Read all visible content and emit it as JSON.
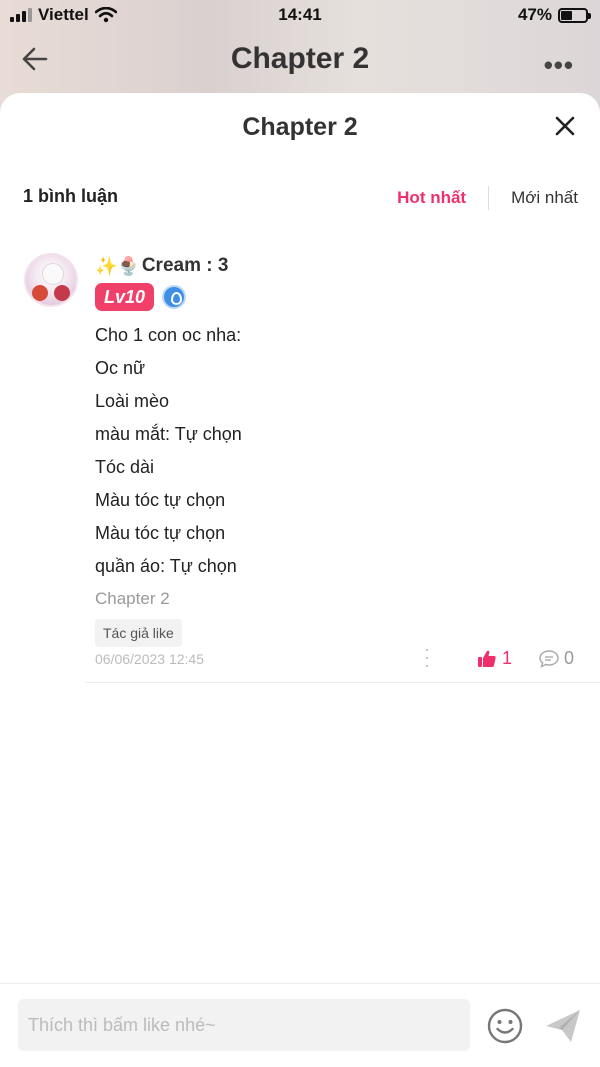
{
  "status_bar": {
    "carrier": "Viettel",
    "time": "14:41",
    "battery": "47%",
    "battery_level": 0.47
  },
  "app_header": {
    "title": "Chapter 2"
  },
  "sheet": {
    "title": "Chapter 2",
    "comment_count": "1 bình luận",
    "sort_hot": "Hot nhất",
    "sort_new": "Mới nhất"
  },
  "comment": {
    "username": "Cream : 3",
    "username_emoji": "✨🍨",
    "level": "Lv10",
    "lines": [
      "Cho 1 con oc nha:",
      "Oc nữ",
      "Loài mèo",
      "màu mắt: Tự chọn",
      "Tóc dài",
      "Màu tóc tự chọn",
      "Màu tóc tự chọn",
      "quần áo: Tự chọn"
    ],
    "chapter_ref": "Chapter 2",
    "tag": "Tác giả like",
    "date": "06/06/2023 12:45",
    "likes": "1",
    "replies": "0"
  },
  "input": {
    "placeholder": "Thích thì bấm like nhé~"
  },
  "colors": {
    "accent": "#f0306a",
    "level_badge": "#f0406a"
  }
}
